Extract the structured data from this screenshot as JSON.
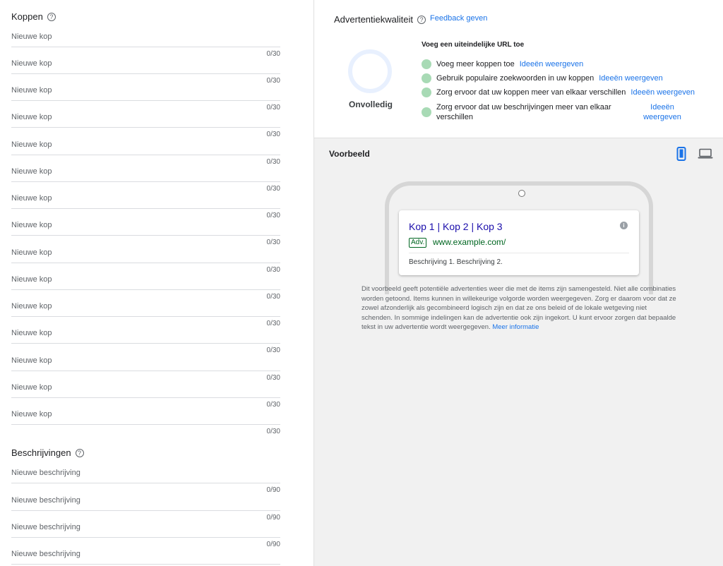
{
  "koppen": {
    "title": "Koppen",
    "placeholder": "Nieuwe kop",
    "items": [
      {
        "placeholder": "Nieuwe kop",
        "counter": "0/30"
      },
      {
        "placeholder": "Nieuwe kop",
        "counter": "0/30"
      },
      {
        "placeholder": "Nieuwe kop",
        "counter": "0/30"
      },
      {
        "placeholder": "Nieuwe kop",
        "counter": "0/30"
      },
      {
        "placeholder": "Nieuwe kop",
        "counter": "0/30"
      },
      {
        "placeholder": "Nieuwe kop",
        "counter": "0/30"
      },
      {
        "placeholder": "Nieuwe kop",
        "counter": "0/30"
      },
      {
        "placeholder": "Nieuwe kop",
        "counter": "0/30"
      },
      {
        "placeholder": "Nieuwe kop",
        "counter": "0/30"
      },
      {
        "placeholder": "Nieuwe kop",
        "counter": "0/30"
      },
      {
        "placeholder": "Nieuwe kop",
        "counter": "0/30"
      },
      {
        "placeholder": "Nieuwe kop",
        "counter": "0/30"
      },
      {
        "placeholder": "Nieuwe kop",
        "counter": "0/30"
      },
      {
        "placeholder": "Nieuwe kop",
        "counter": "0/30"
      },
      {
        "placeholder": "Nieuwe kop",
        "counter": "0/30"
      }
    ]
  },
  "beschrijvingen": {
    "title": "Beschrijvingen",
    "items": [
      {
        "placeholder": "Nieuwe beschrijving",
        "counter": "0/90"
      },
      {
        "placeholder": "Nieuwe beschrijving",
        "counter": "0/90"
      },
      {
        "placeholder": "Nieuwe beschrijving",
        "counter": "0/90"
      },
      {
        "placeholder": "Nieuwe beschrijving",
        "counter": ""
      }
    ]
  },
  "quality": {
    "title": "Advertentiekwaliteit",
    "feedback_link": "Feedback geven",
    "status": "Onvolledig",
    "heading": "Voeg een uiteindelijke URL toe",
    "suggestions": [
      {
        "text": "Voeg meer koppen toe",
        "link": "Ideeën weergeven"
      },
      {
        "text": "Gebruik populaire zoekwoorden in uw koppen",
        "link": "Ideeën weergeven"
      },
      {
        "text": "Zorg ervoor dat uw koppen meer van elkaar verschillen",
        "link": "Ideeën weergeven"
      },
      {
        "text": "Zorg ervoor dat uw beschrijvingen meer van elkaar verschillen",
        "link": "Ideeën weergeven"
      }
    ],
    "dot_color": "#a8dab5"
  },
  "preview": {
    "title": "Voorbeeld",
    "devices": [
      "mobile-icon",
      "desktop-icon"
    ],
    "selected_device": "mobile",
    "ad": {
      "headline": "Kop 1 | Kop 2 | Kop 3",
      "badge": "Adv.",
      "url": "www.example.com/",
      "description": "Beschrijving 1. Beschrijving 2."
    },
    "disclaimer": "Dit voorbeeld geeft potentiële advertenties weer die met de items zijn samengesteld. Niet alle combinaties worden getoond. Items kunnen in willekeurige volgorde worden weergegeven. Zorg er daarom voor dat ze zowel afzonderlijk als gecombineerd logisch zijn en dat ze ons beleid of de lokale wetgeving niet schenden. In sommige indelingen kan de advertentie ook zijn ingekort. U kunt ervoor zorgen dat bepaalde tekst in uw advertentie wordt weergegeven.",
    "more_info_link": "Meer informatie"
  },
  "colors": {
    "link": "#1a73e8",
    "accent_blue": "#1a73e8",
    "ad_headline": "#1a0dab",
    "ad_url": "#006621"
  }
}
